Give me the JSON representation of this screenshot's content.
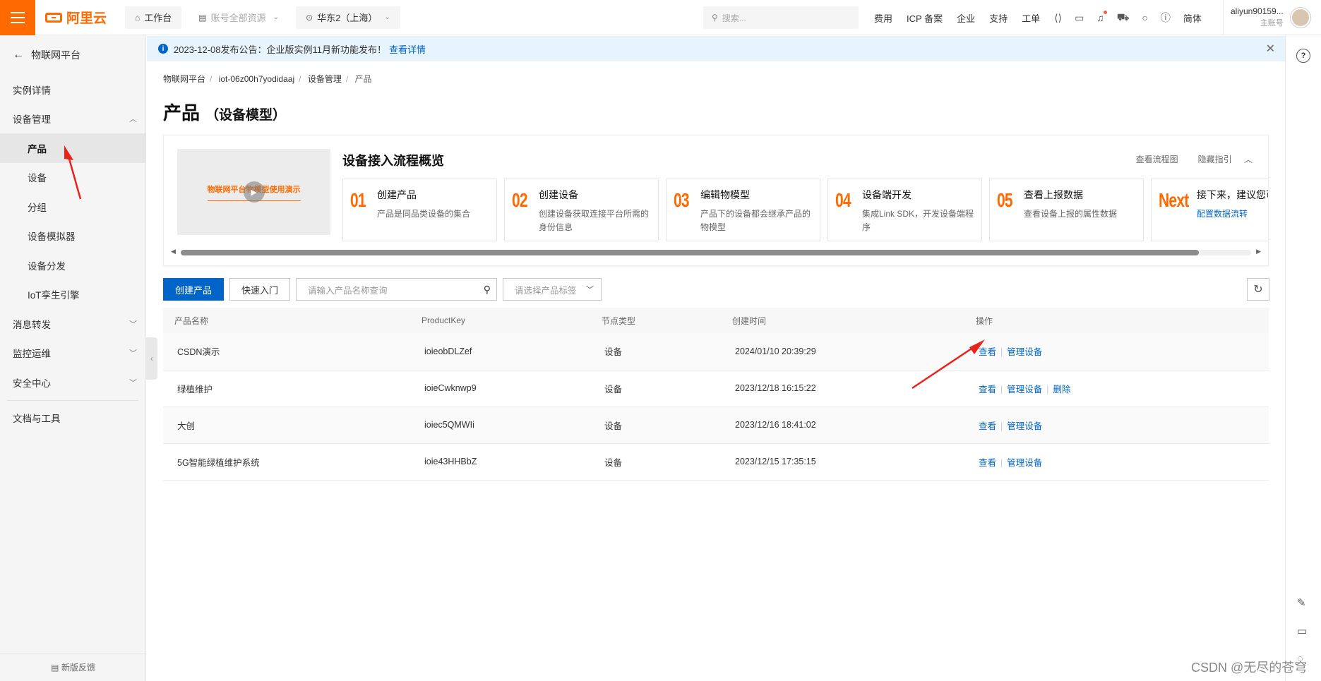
{
  "topbar": {
    "brand": "阿里云",
    "workbench": "工作台",
    "resources": "账号全部资源",
    "region": "华东2（上海）",
    "search_placeholder": "搜索...",
    "links": [
      "费用",
      "ICP 备案",
      "企业",
      "支持",
      "工单"
    ],
    "lang": "简体",
    "user_name": "aliyun90159...",
    "user_role": "主账号"
  },
  "sidebar": {
    "back_label": "物联网平台",
    "items": [
      {
        "label": "实例详情"
      },
      {
        "label": "设备管理"
      },
      {
        "label": "产品"
      },
      {
        "label": "设备"
      },
      {
        "label": "分组"
      },
      {
        "label": "设备模拟器"
      },
      {
        "label": "设备分发"
      },
      {
        "label": "IoT孪生引擎"
      },
      {
        "label": "消息转发"
      },
      {
        "label": "监控运维"
      },
      {
        "label": "安全中心"
      },
      {
        "label": "文档与工具"
      }
    ],
    "feedback": "新版反馈"
  },
  "notice": {
    "text": "2023-12-08发布公告：企业版实例11月新功能发布！",
    "link": "查看详情"
  },
  "breadcrumb": [
    "物联网平台",
    "iot-06z00h7yodidaaj",
    "设备管理",
    "产品"
  ],
  "page": {
    "title": "产品",
    "subtitle": "（设备模型）"
  },
  "guide": {
    "video_title": "物联网平台物模型使用演示",
    "title": "设备接入流程概览",
    "view_flow": "查看流程图",
    "hide_guide": "隐藏指引",
    "steps": [
      {
        "num": "01",
        "title": "创建产品",
        "desc": "产品是同品类设备的集合"
      },
      {
        "num": "02",
        "title": "创建设备",
        "desc": "创建设备获取连接平台所需的身份信息"
      },
      {
        "num": "03",
        "title": "编辑物模型",
        "desc": "产品下的设备都会继承产品的物模型"
      },
      {
        "num": "04",
        "title": "设备端开发",
        "desc": "集成Link SDK，开发设备端程序"
      },
      {
        "num": "05",
        "title": "查看上报数据",
        "desc": "查看设备上报的属性数据"
      },
      {
        "num": "Next",
        "title": "接下来，建议您可",
        "link": "配置数据流转"
      }
    ]
  },
  "toolbar": {
    "create_label": "创建产品",
    "quickstart_label": "快速入门",
    "search_placeholder": "请输入产品名称查询",
    "tag_placeholder": "请选择产品标签"
  },
  "table": {
    "headers": [
      "产品名称",
      "ProductKey",
      "节点类型",
      "创建时间",
      "操作"
    ],
    "rows": [
      {
        "name": "CSDN演示",
        "key": "ioieobDLZef",
        "node": "设备",
        "time": "2024/01/10 20:39:29",
        "ops": [
          "查看",
          "管理设备"
        ]
      },
      {
        "name": "绿植维护",
        "key": "ioieCwknwp9",
        "node": "设备",
        "time": "2023/12/18 16:15:22",
        "ops": [
          "查看",
          "管理设备",
          "删除"
        ]
      },
      {
        "name": "大创",
        "key": "ioiec5QMWIi",
        "node": "设备",
        "time": "2023/12/16 18:41:02",
        "ops": [
          "查看",
          "管理设备"
        ]
      },
      {
        "name": "5G智能绿植维护系统",
        "key": "ioie43HHBbZ",
        "node": "设备",
        "time": "2023/12/15 17:35:15",
        "ops": [
          "查看",
          "管理设备"
        ]
      }
    ]
  },
  "watermark": "CSDN @无尽的苍穹",
  "colors": {
    "brand": "#ff6a00",
    "primary": "#0064c8",
    "annotation": "#e8231a"
  }
}
